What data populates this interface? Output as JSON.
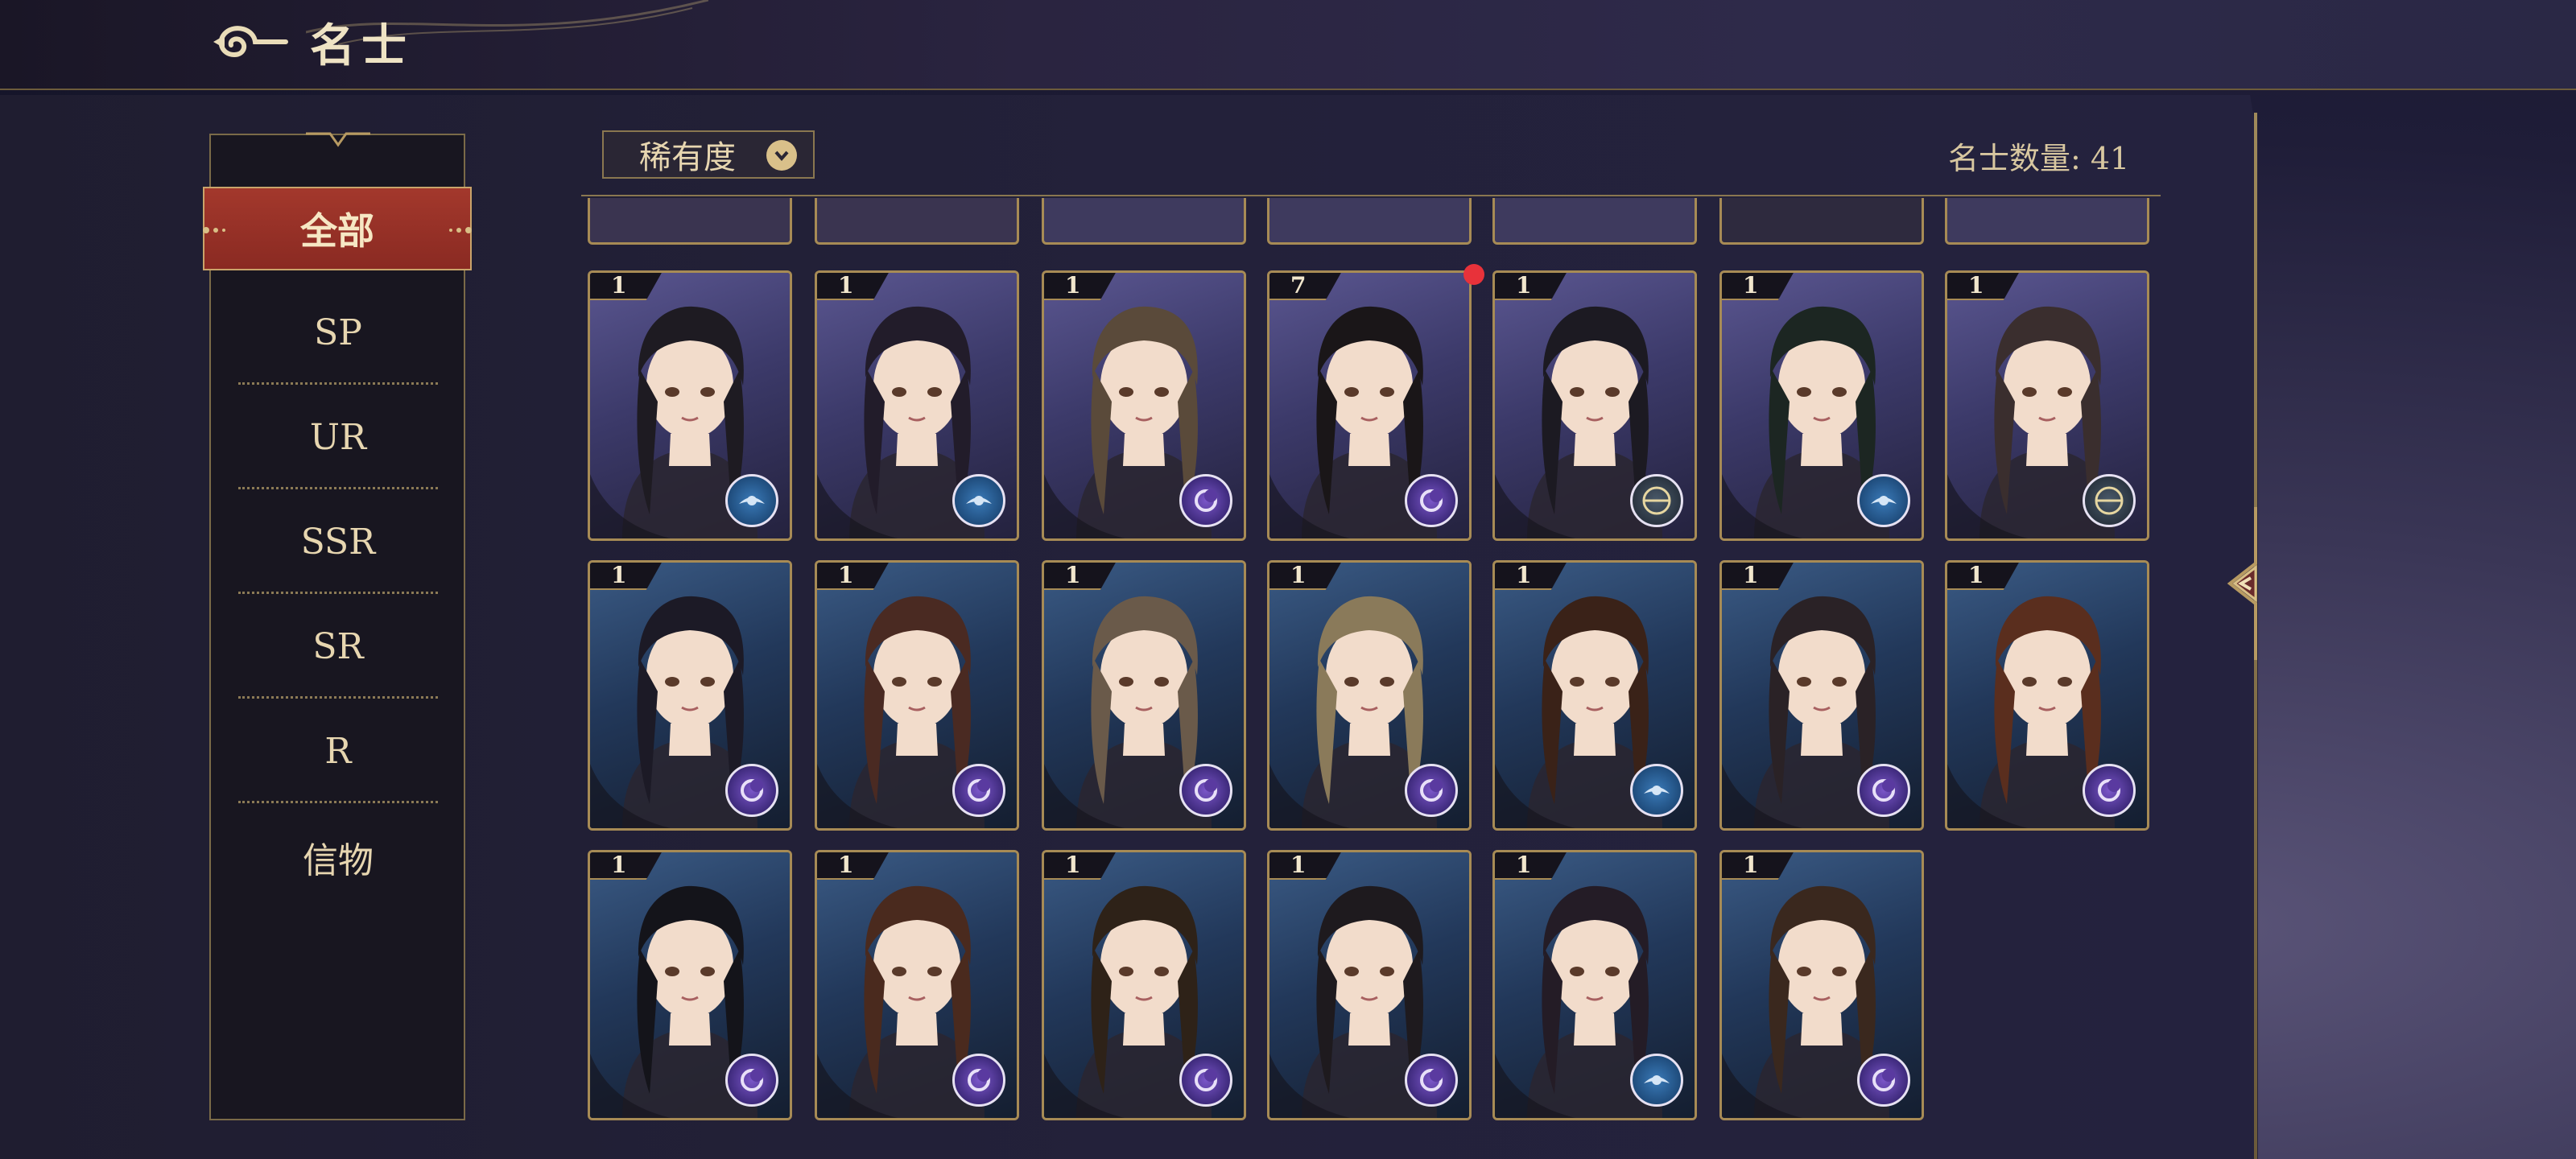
{
  "header": {
    "title": "名士"
  },
  "sidebar": {
    "items": [
      {
        "label": "全部",
        "active": true
      },
      {
        "label": "SP"
      },
      {
        "label": "UR"
      },
      {
        "label": "SSR"
      },
      {
        "label": "SR"
      },
      {
        "label": "R"
      },
      {
        "label": "信物"
      }
    ]
  },
  "filter": {
    "label": "稀有度",
    "icon": "chevron-down-icon"
  },
  "count": {
    "label": "名士数量: 41"
  },
  "colors": {
    "accent_gold": "#a78b55",
    "active_red": "#a3382c",
    "badge_blue": "#1f5c8c",
    "badge_purple": "#4a2c8c",
    "notification_red": "#e8323a"
  },
  "cards": [
    {
      "count": "1",
      "badge": "blue",
      "theme": "purple"
    },
    {
      "count": "1",
      "badge": "blue",
      "theme": "purple"
    },
    {
      "count": "1",
      "badge": "purple",
      "theme": "purple"
    },
    {
      "count": "7",
      "badge": "purple",
      "theme": "purple",
      "notification": true
    },
    {
      "count": "1",
      "badge": "compass",
      "theme": "purple"
    },
    {
      "count": "1",
      "badge": "blue",
      "theme": "purple"
    },
    {
      "count": "1",
      "badge": "compass",
      "theme": "purple"
    },
    {
      "count": "1",
      "badge": "purple",
      "theme": "blue"
    },
    {
      "count": "1",
      "badge": "purple",
      "theme": "blue"
    },
    {
      "count": "1",
      "badge": "purple",
      "theme": "blue"
    },
    {
      "count": "1",
      "badge": "purple",
      "theme": "blue"
    },
    {
      "count": "1",
      "badge": "blue",
      "theme": "blue"
    },
    {
      "count": "1",
      "badge": "purple",
      "theme": "blue"
    },
    {
      "count": "1",
      "badge": "purple",
      "theme": "blue"
    },
    {
      "count": "1",
      "badge": "purple",
      "theme": "blue"
    },
    {
      "count": "1",
      "badge": "purple",
      "theme": "blue"
    },
    {
      "count": "1",
      "badge": "purple",
      "theme": "blue"
    },
    {
      "count": "1",
      "badge": "purple",
      "theme": "blue"
    },
    {
      "count": "1",
      "badge": "blue",
      "theme": "blue"
    },
    {
      "count": "1",
      "badge": "purple",
      "theme": "blue"
    }
  ]
}
